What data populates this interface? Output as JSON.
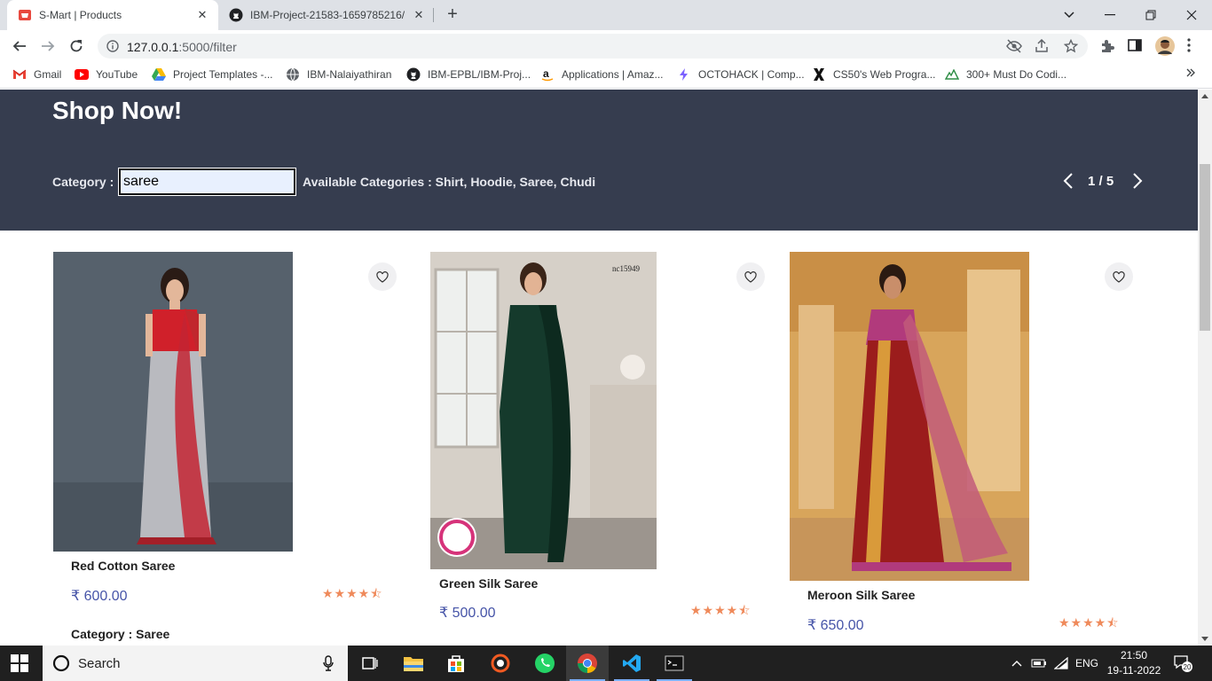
{
  "browser": {
    "tabs": [
      {
        "title": "S-Mart | Products",
        "active": true
      },
      {
        "title": "IBM-Project-21583-1659785216/",
        "active": false
      }
    ],
    "url_host": "127.0.0.1",
    "url_path": ":5000/filter",
    "bookmarks": [
      {
        "label": "Gmail",
        "icon": "gmail-icon"
      },
      {
        "label": "YouTube",
        "icon": "youtube-icon"
      },
      {
        "label": "Project Templates -...",
        "icon": "google-drive-icon"
      },
      {
        "label": "IBM-Nalaiyathiran",
        "icon": "globe-icon"
      },
      {
        "label": "IBM-EPBL/IBM-Proj...",
        "icon": "github-icon"
      },
      {
        "label": "Applications | Amaz...",
        "icon": "amazon-icon"
      },
      {
        "label": "OCTOHACK | Comp...",
        "icon": "octohack-icon"
      },
      {
        "label": "CS50's Web Progra...",
        "icon": "edx-icon"
      },
      {
        "label": "300+ Must Do Codi...",
        "icon": "geeks-icon"
      }
    ]
  },
  "hero": {
    "title": "Shop Now!",
    "category_label": "Category :",
    "category_value": "saree",
    "available": "Available Categories : Shirt, Hoodie, Saree, Chudi",
    "page": "1 / 5"
  },
  "products": [
    {
      "name": "Red Cotton Saree",
      "price": "₹ 600.00",
      "rating": 4.5,
      "stars": "★★★★⯪",
      "category": "Category : Saree",
      "colors": {
        "bg": "#4f5a66",
        "blouse": "#d0202a",
        "drape": "#b8b9bf",
        "accent": "#c1272d"
      }
    },
    {
      "name": "Green Silk Saree",
      "price": "₹ 500.00",
      "rating": 4.5,
      "stars": "★★★★⯪",
      "code": "nc15949",
      "colors": {
        "bg": "#d8d2cb",
        "drape": "#153a2c",
        "accent": "#0d2a1f"
      }
    },
    {
      "name": "Meroon Silk Saree",
      "price": "₹ 650.00",
      "rating": 4.5,
      "stars": "★★★★⯪",
      "colors": {
        "bg": "#d9a65a",
        "drape": "#9b1c1c",
        "accent": "#b13a7c"
      }
    }
  ],
  "taskbar": {
    "search_label": "Search",
    "language": "ENG",
    "time": "21:50",
    "date": "19-11-2022",
    "notifications": "20"
  }
}
